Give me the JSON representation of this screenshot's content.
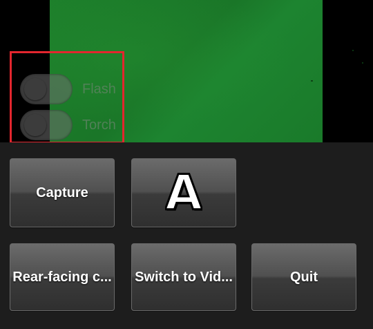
{
  "overlay": {
    "flash": {
      "label": "Flash",
      "enabled": false
    },
    "torch": {
      "label": "Torch",
      "enabled": false
    }
  },
  "controls": {
    "capture_label": "Capture",
    "mode_glyph": "A",
    "camera_label": "Rear-facing c...",
    "switch_label": "Switch to Vid...",
    "quit_label": "Quit"
  },
  "colors": {
    "highlight_border": "#e3262e",
    "preview_green": "#1d7f2b",
    "panel_background": "#1d1d1d"
  },
  "icons": {
    "mode": "auto-mode-icon"
  }
}
